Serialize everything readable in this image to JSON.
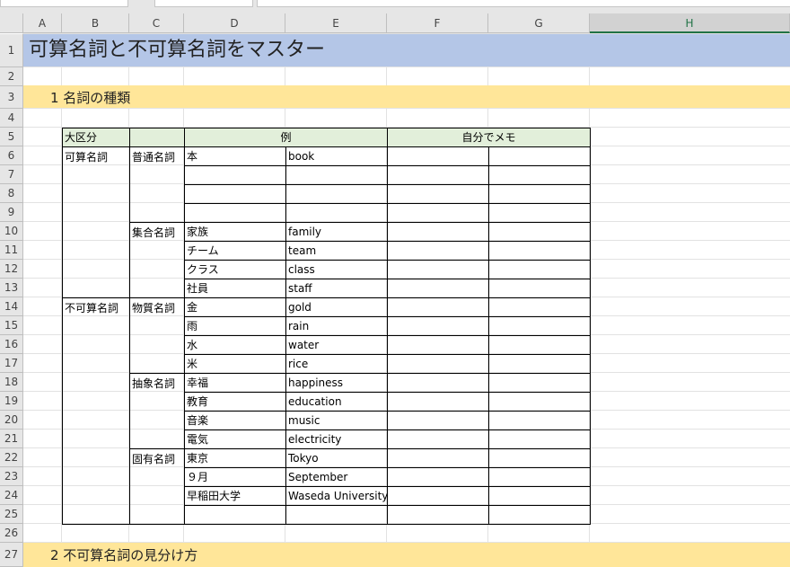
{
  "columns": [
    "A",
    "B",
    "C",
    "D",
    "E",
    "F",
    "G",
    "H"
  ],
  "rows": [
    "1",
    "2",
    "3",
    "4",
    "5",
    "6",
    "7",
    "8",
    "9",
    "10",
    "11",
    "12",
    "13",
    "14",
    "15",
    "16",
    "17",
    "18",
    "19",
    "20",
    "21",
    "22",
    "23",
    "24",
    "25",
    "26",
    "27"
  ],
  "title": "可算名詞と不可算名詞をマスター",
  "section1": "1 名詞の種類",
  "section2": "2 不可算名詞の見分け方",
  "table": {
    "header_major": "大区分",
    "header_example": "例",
    "header_memo": "自分でメモ",
    "major_countable": "可算名詞",
    "major_uncountable": "不可算名詞",
    "sub_common": "普通名詞",
    "sub_collective": "集合名詞",
    "sub_material": "物質名詞",
    "sub_abstract": "抽象名詞",
    "sub_proper": "固有名詞",
    "examples": [
      {
        "jp": "本",
        "en": "book"
      },
      {
        "jp": "",
        "en": ""
      },
      {
        "jp": "",
        "en": ""
      },
      {
        "jp": "",
        "en": ""
      },
      {
        "jp": "家族",
        "en": "family"
      },
      {
        "jp": "チーム",
        "en": "team"
      },
      {
        "jp": "クラス",
        "en": "class"
      },
      {
        "jp": "社員",
        "en": "staff"
      },
      {
        "jp": "金",
        "en": "gold"
      },
      {
        "jp": "雨",
        "en": "rain"
      },
      {
        "jp": "水",
        "en": "water"
      },
      {
        "jp": "米",
        "en": "rice"
      },
      {
        "jp": "幸福",
        "en": "happiness"
      },
      {
        "jp": "教育",
        "en": "education"
      },
      {
        "jp": "音楽",
        "en": "music"
      },
      {
        "jp": "電気",
        "en": "electricity"
      },
      {
        "jp": "東京",
        "en": "Tokyo"
      },
      {
        "jp": "９月",
        "en": "September"
      },
      {
        "jp": "早稲田大学",
        "en": "Waseda University"
      },
      {
        "jp": "",
        "en": ""
      }
    ]
  },
  "colors": {
    "title_band": "#b4c6e7",
    "section_band": "#ffe699",
    "table_header": "#e2efda",
    "selected_column_accent": "#217346"
  }
}
